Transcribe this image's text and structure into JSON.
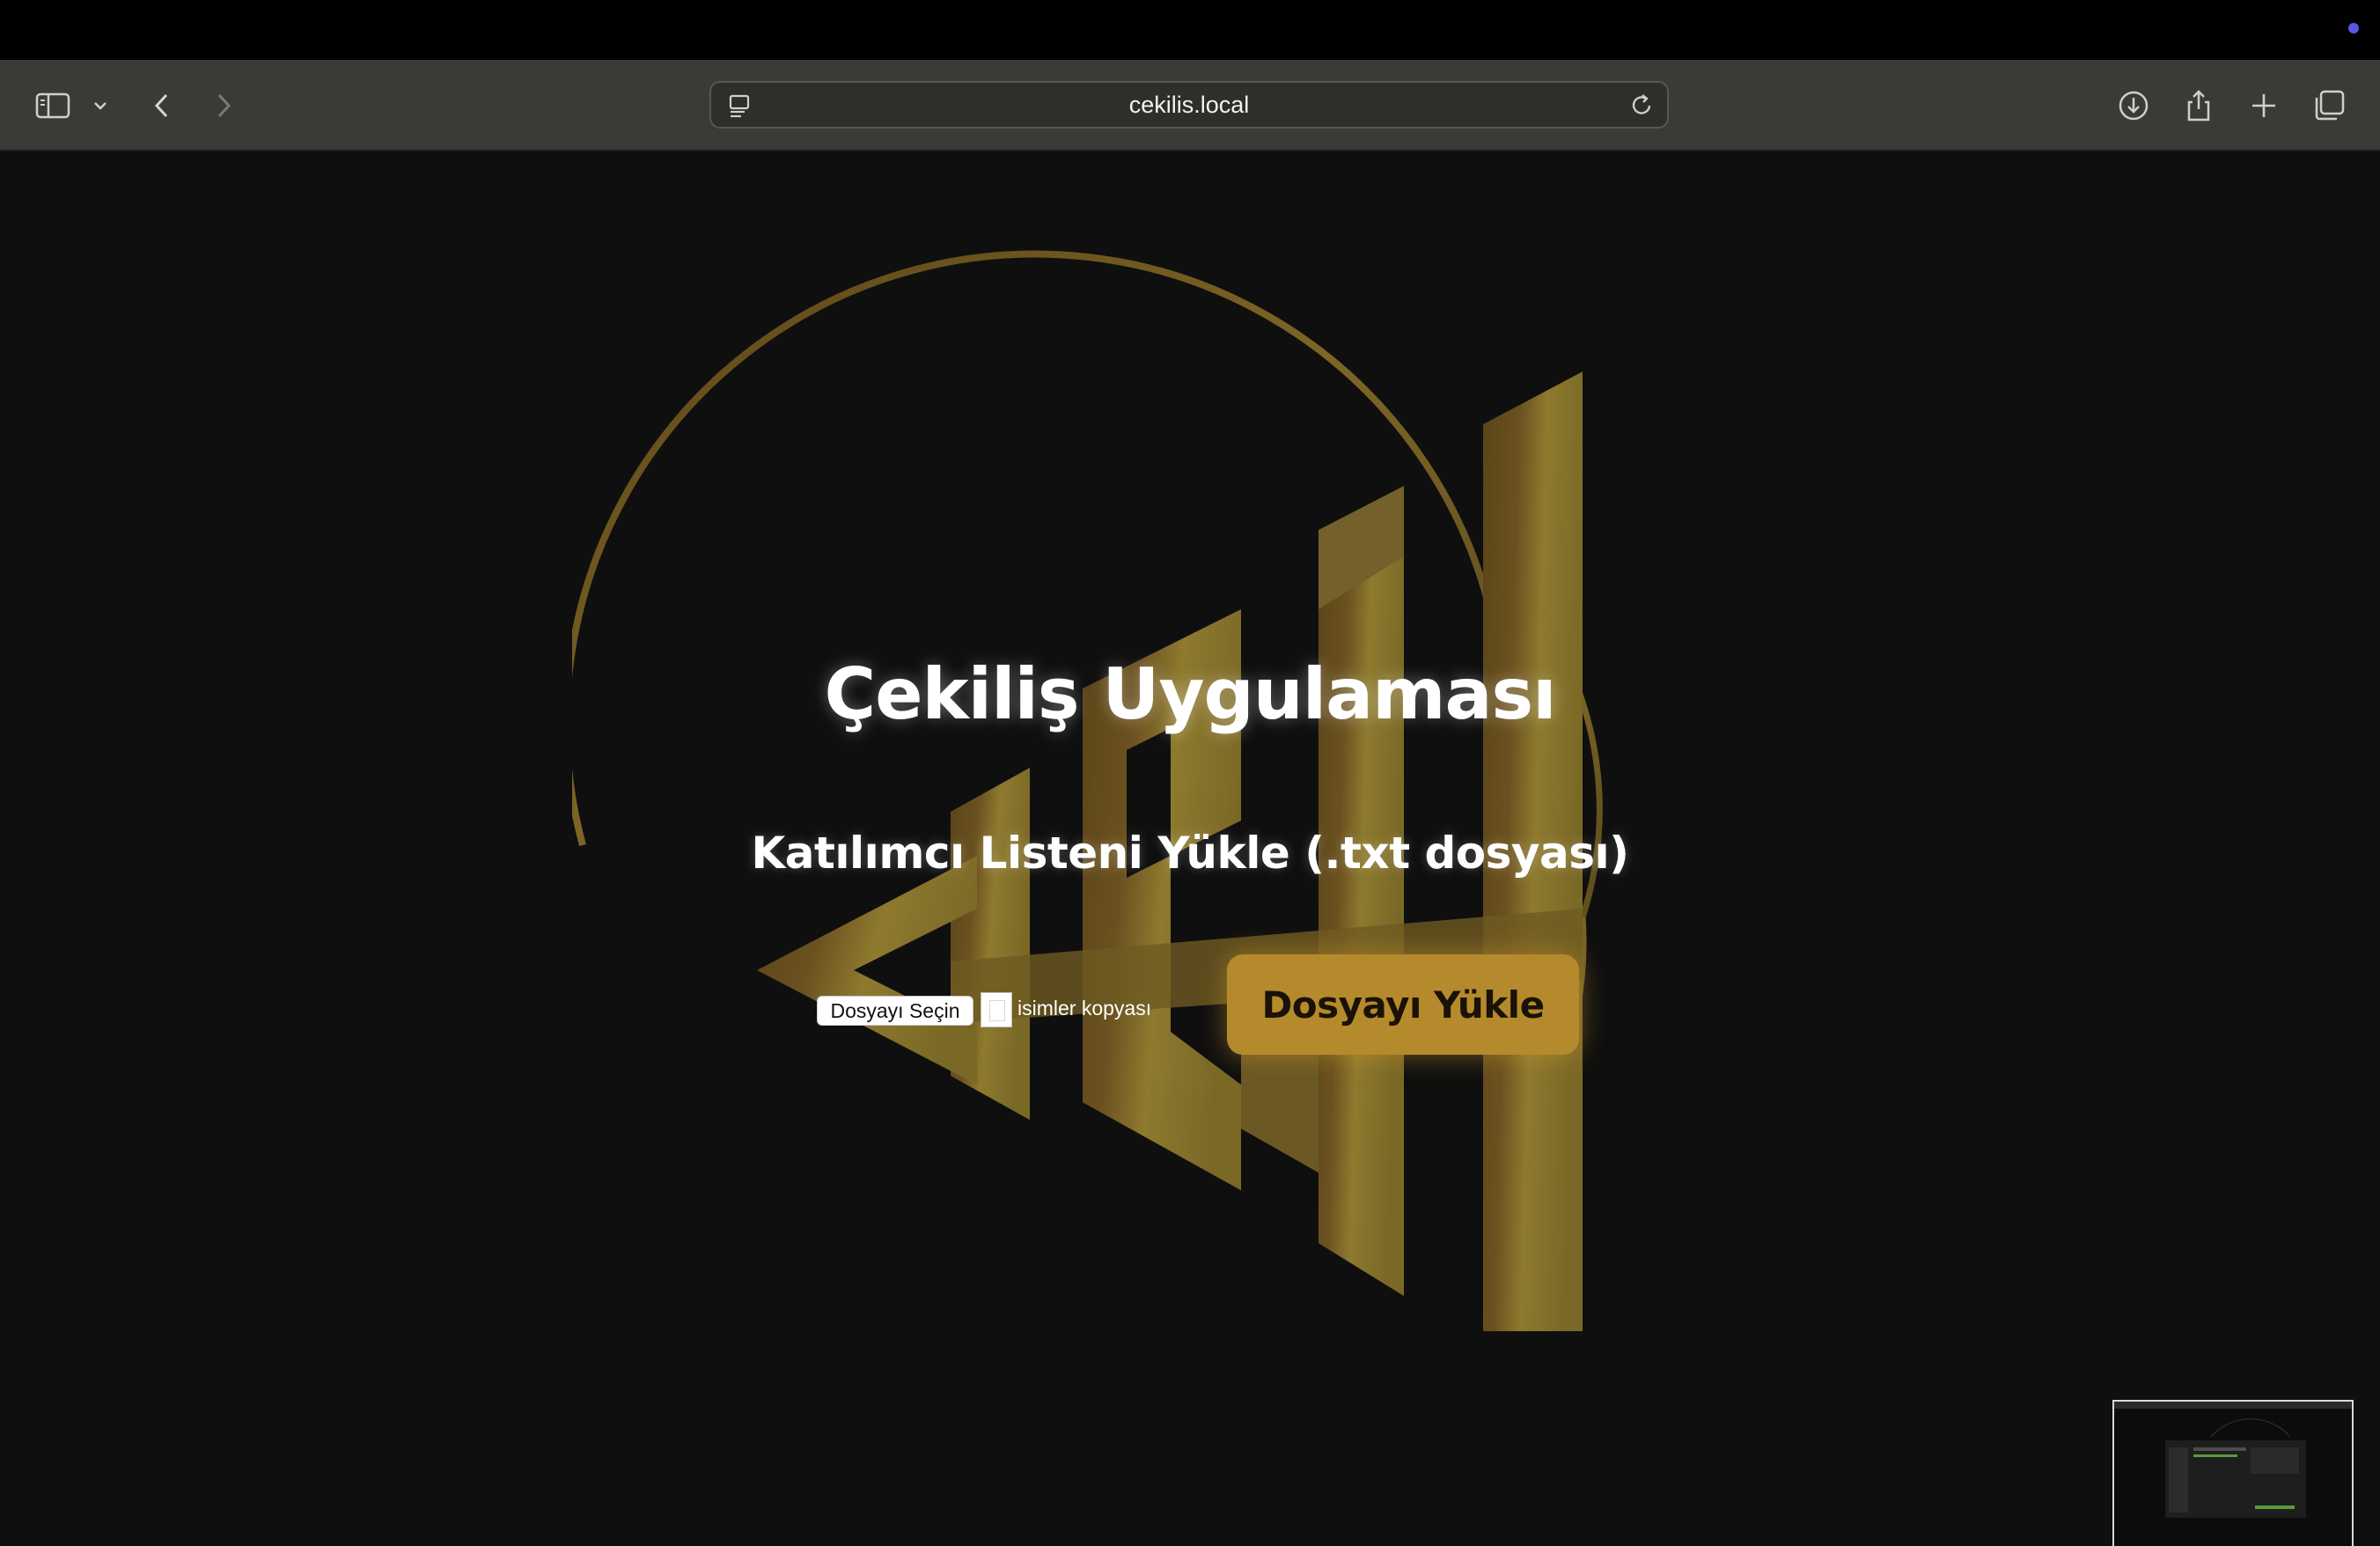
{
  "browser": {
    "url": "cekilis.local",
    "icons": {
      "sidebar": "sidebar-icon",
      "chevron": "chevron-down-icon",
      "back": "back-icon",
      "forward": "forward-icon",
      "reader": "reader-icon",
      "reload": "reload-icon",
      "download": "download-icon",
      "share": "share-icon",
      "new_tab": "plus-icon",
      "tabs": "tabs-overview-icon"
    }
  },
  "page": {
    "title": "Çekiliş Uygulaması",
    "subtitle": "Katılımcı Listeni Yükle (.txt dosyası)",
    "file_input": {
      "button_label": "Dosyayı Seçin",
      "file_name": "isimler kopyası"
    },
    "upload_button": "Dosyayı Yükle"
  },
  "colors": {
    "accent_gold": "#b58a2c",
    "background": "#0f0f0f"
  }
}
